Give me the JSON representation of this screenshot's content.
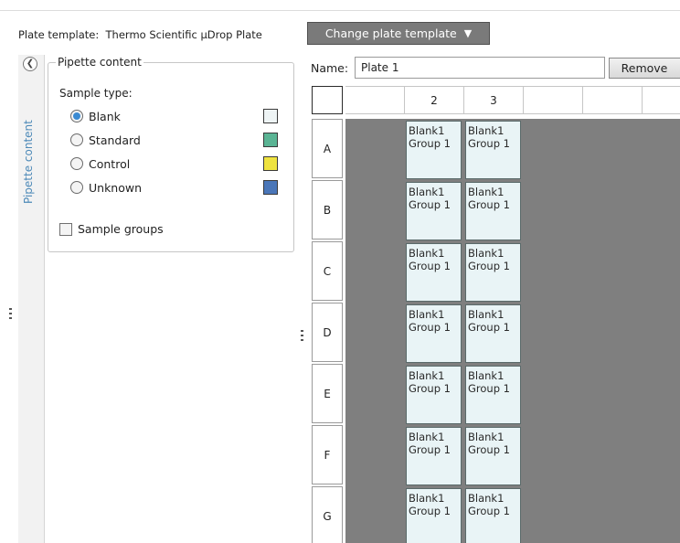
{
  "header": {
    "plate_template_label": "Plate template:",
    "plate_template_value": "Thermo Scientific µDrop Plate",
    "change_template_label": "Change plate template",
    "change_template_arrow": "▼"
  },
  "sidebar": {
    "collapse_glyph": "❮",
    "title": "Pipette content"
  },
  "pipette_panel": {
    "legend": "Pipette content",
    "sample_type_label": "Sample type:",
    "options": [
      {
        "label": "Blank",
        "selected": true,
        "color": "#eef4f5"
      },
      {
        "label": "Standard",
        "selected": false,
        "color": "#5ab494"
      },
      {
        "label": "Control",
        "selected": false,
        "color": "#efe33f"
      },
      {
        "label": "Unknown",
        "selected": false,
        "color": "#4a76b8"
      }
    ],
    "sample_groups_label": "Sample groups",
    "sample_groups_checked": false
  },
  "plate": {
    "name_label": "Name:",
    "name_value": "Plate 1",
    "remove_label": "Remove",
    "column_headers": [
      "",
      "2",
      "3",
      "",
      "",
      ""
    ],
    "row_headers": [
      "A",
      "B",
      "C",
      "D",
      "E",
      "F",
      "G"
    ],
    "wells": {
      "col2": {
        "line1": "Blank1",
        "line2": "Group 1"
      },
      "col3": {
        "line1": "Blank1",
        "line2": "Group 1"
      }
    },
    "colors": {
      "plate_background": "#7f7f7f",
      "well_fill": "#e9f4f6"
    }
  }
}
